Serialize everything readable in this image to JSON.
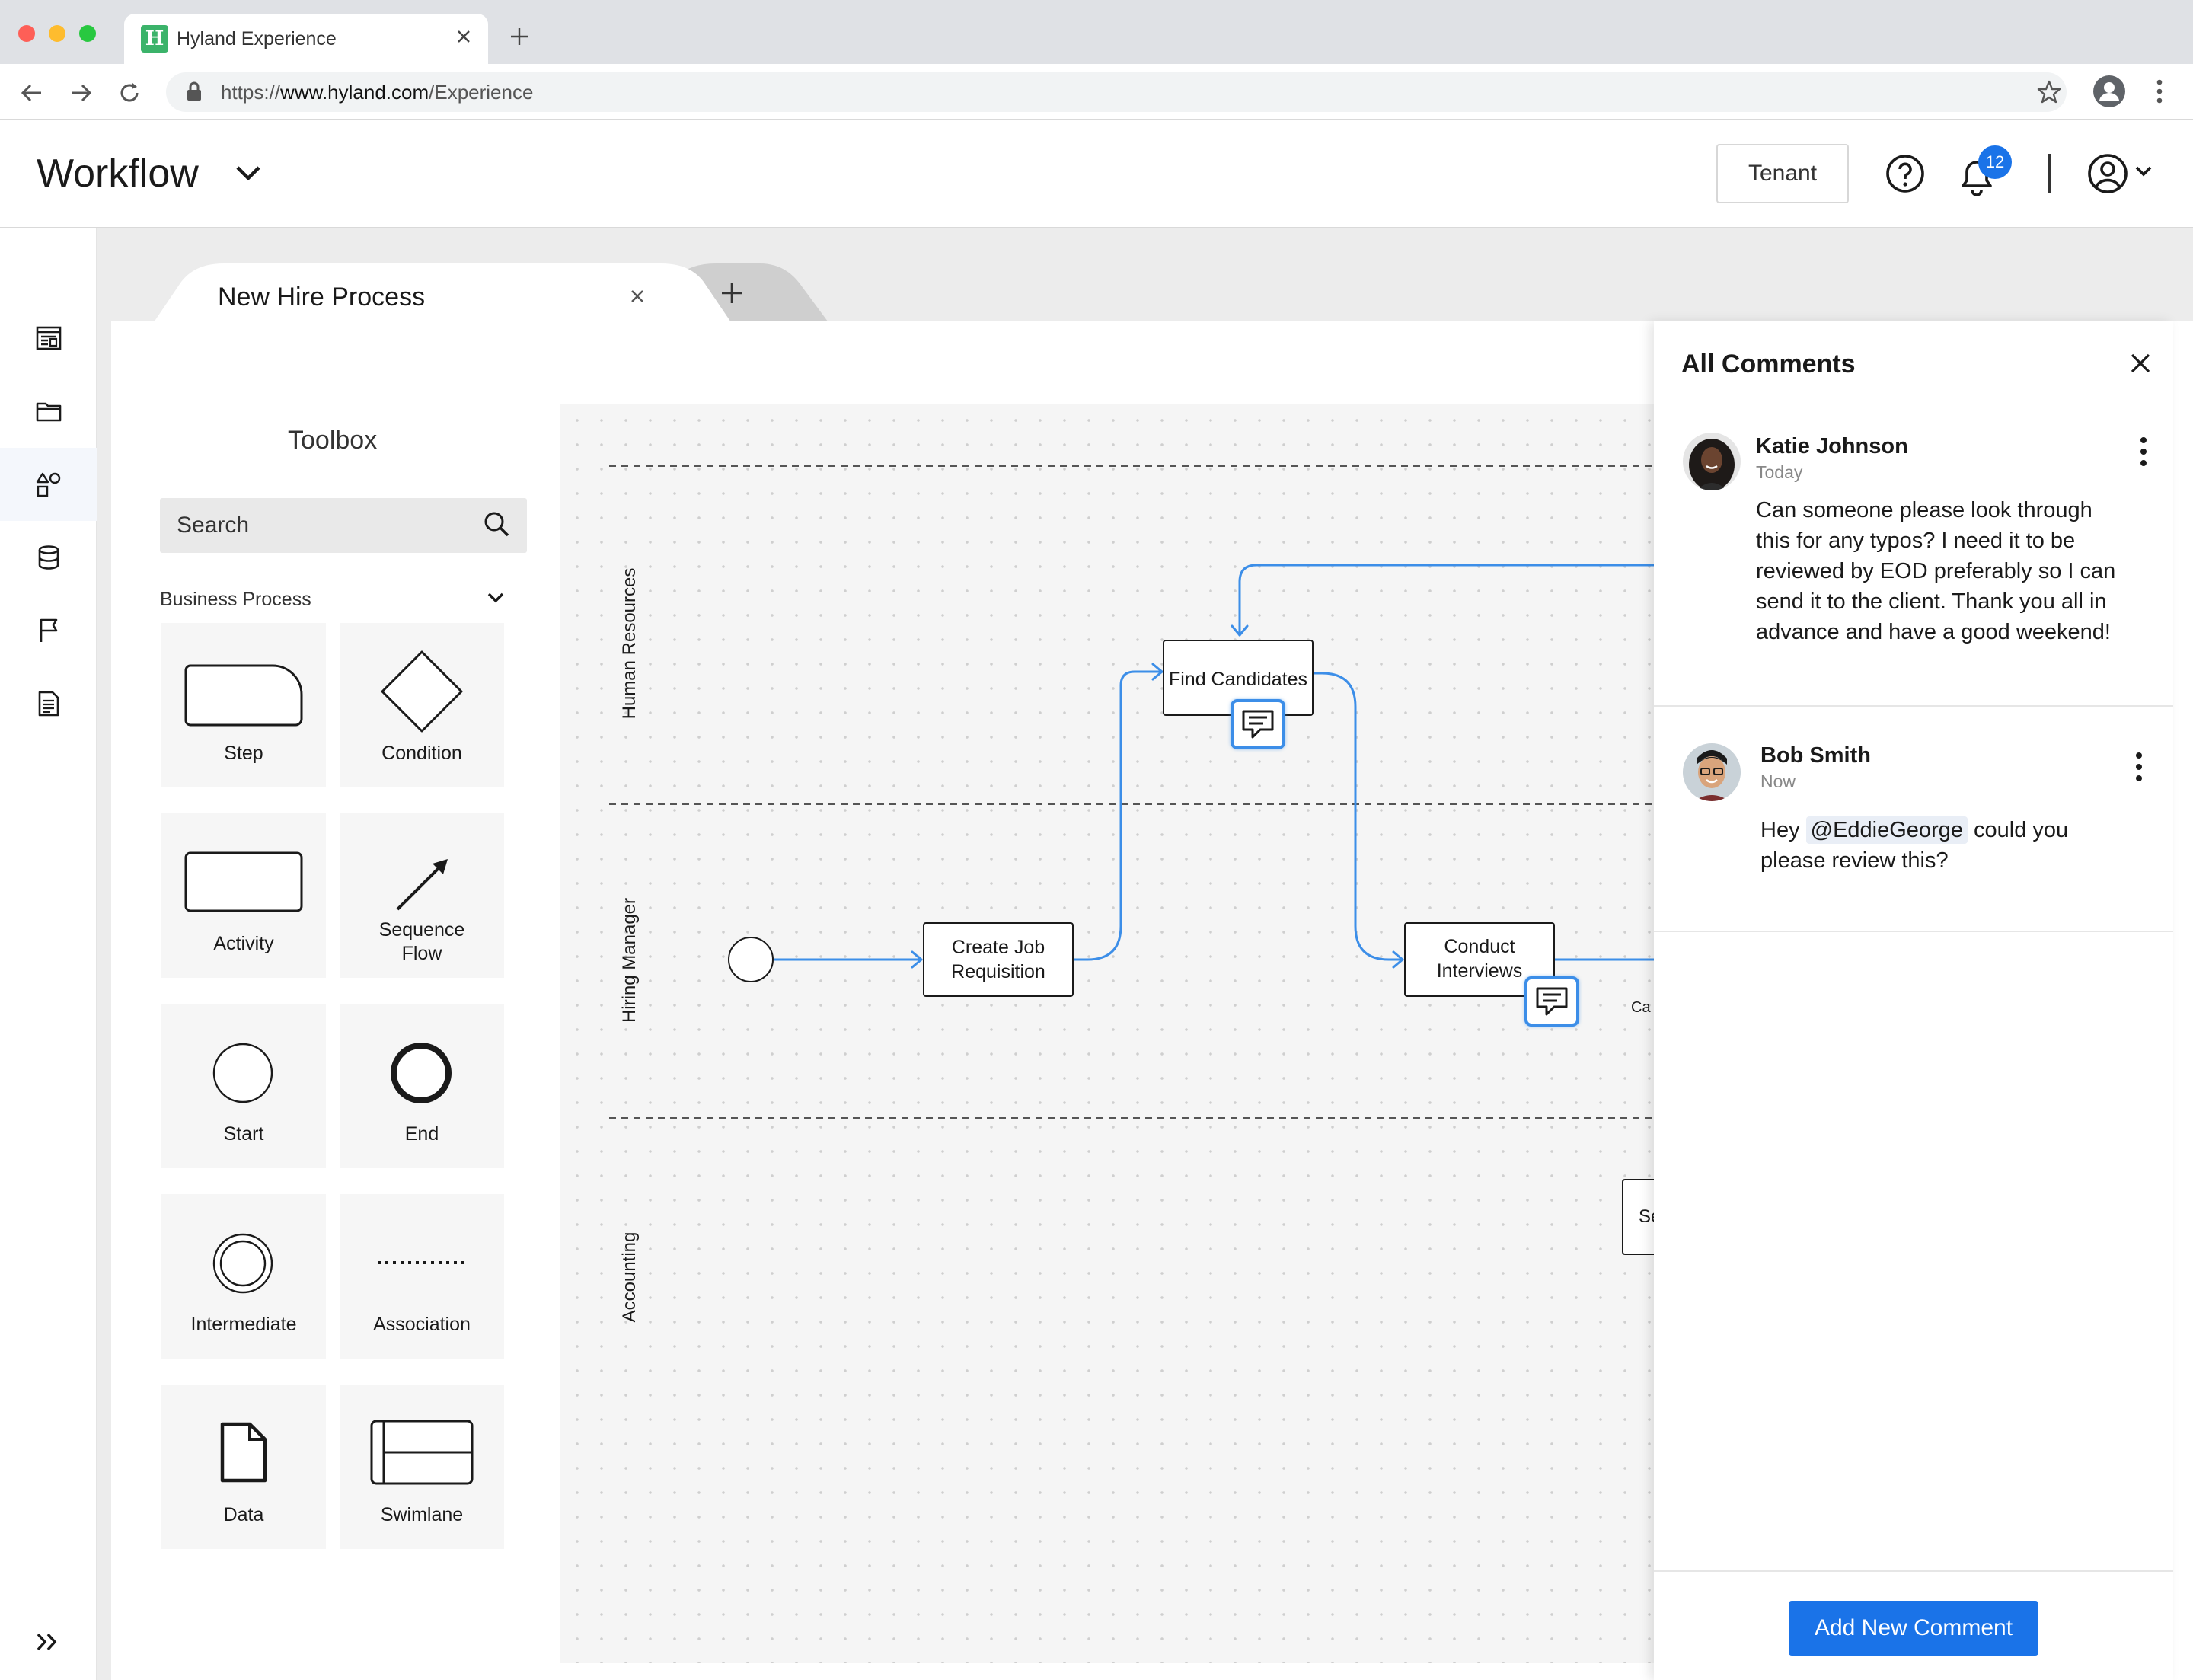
{
  "browser": {
    "tab_title": "Hyland Experience",
    "favicon_letter": "H",
    "url_prefix": "https://",
    "url_domain": "www.hyland.com",
    "url_path": "/Experience"
  },
  "header": {
    "app_title": "Workflow",
    "tenant_label": "Tenant",
    "notification_count": "12"
  },
  "document": {
    "tab_title": "New Hire Process"
  },
  "toolbox": {
    "title": "Toolbox",
    "search_placeholder": "Search",
    "section_label": "Business Process",
    "tools": [
      {
        "label": "Step",
        "icon": "step-shape-icon"
      },
      {
        "label": "Condition",
        "icon": "diamond-icon"
      },
      {
        "label": "Activity",
        "icon": "rectangle-icon"
      },
      {
        "label": "Sequence Flow",
        "icon": "arrow-icon"
      },
      {
        "label": "Start",
        "icon": "thin-circle-icon"
      },
      {
        "label": "End",
        "icon": "thick-circle-icon"
      },
      {
        "label": "Intermediate",
        "icon": "double-circle-icon"
      },
      {
        "label": "Association",
        "icon": "dotted-line-icon"
      },
      {
        "label": "Data",
        "icon": "document-icon"
      },
      {
        "label": "Swimlane",
        "icon": "swimlane-icon"
      }
    ]
  },
  "canvas": {
    "lanes": [
      "Human Resources",
      "Hiring Manager",
      "Accounting"
    ],
    "nodes": {
      "find_candidates": "Find Candidates",
      "create_job_line1": "Create Job",
      "create_job_line2": "Requisition",
      "conduct_line1": "Conduct",
      "conduct_line2": "Interviews",
      "partial_label": "Ca",
      "partial_node": "Se"
    }
  },
  "comments": {
    "title": "All Comments",
    "items": [
      {
        "author": "Katie Johnson",
        "time": "Today",
        "text": "Can someone please look through this for any typos? I need it to be reviewed by EOD preferably so I can send it to the client. Thank you all in advance and have a good weekend!"
      },
      {
        "author": "Bob Smith",
        "time": "Now",
        "text_before": "Hey ",
        "mention": "@EddieGeorge",
        "text_after": " could you please review this?"
      }
    ],
    "add_button": "Add New Comment"
  },
  "colors": {
    "accent": "#1a73e8",
    "flow_line": "#3c8ee8"
  }
}
